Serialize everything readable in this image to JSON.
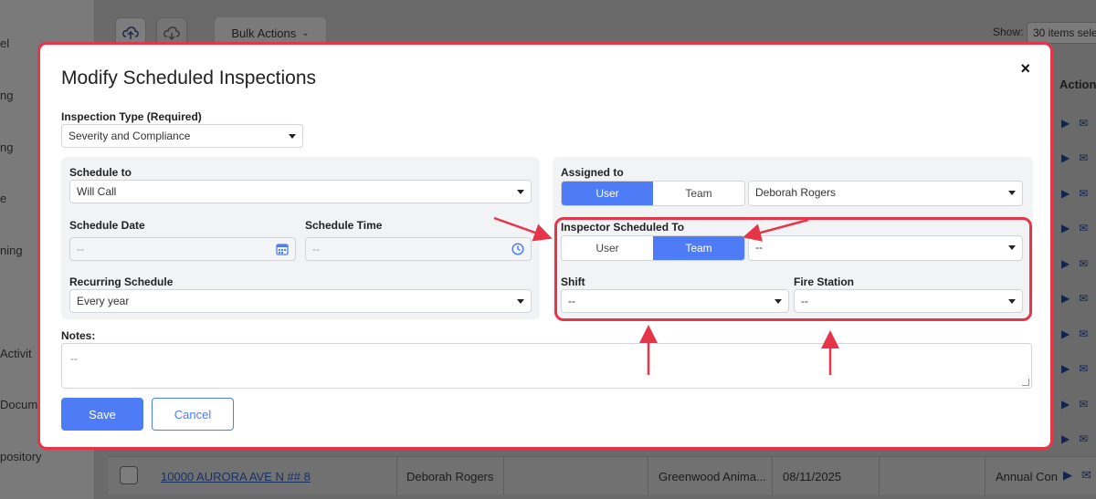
{
  "background": {
    "sidebar_items": [
      "el",
      "ng",
      "ng",
      "e",
      "ning",
      "Activit",
      "Docum",
      "pository"
    ],
    "bulk_actions_label": "Bulk Actions",
    "show_label": "Show:",
    "items_select_value": "30 items sele",
    "actions_header": "Action",
    "bottom_row": {
      "address": "10000 AURORA AVE N ## 8",
      "inspector": "Deborah Rogers",
      "facility": "Greenwood Anima...",
      "date": "08/11/2025",
      "type": "Annual Con"
    }
  },
  "modal": {
    "title": "Modify Scheduled Inspections",
    "close_label": "×",
    "inspection_type": {
      "label": "Inspection Type (Required)",
      "value": "Severity and Compliance"
    },
    "schedule_to": {
      "label": "Schedule to",
      "value": "Will Call"
    },
    "schedule_date": {
      "label": "Schedule Date",
      "placeholder": "--"
    },
    "schedule_time": {
      "label": "Schedule Time",
      "placeholder": "--"
    },
    "recurring": {
      "label": "Recurring Schedule",
      "value": "Every year"
    },
    "assigned_to": {
      "label": "Assigned to",
      "options": [
        "User",
        "Team"
      ],
      "selected": "User",
      "value": "Deborah Rogers"
    },
    "inspector_scheduled_to": {
      "label": "Inspector Scheduled To",
      "options": [
        "User",
        "Team"
      ],
      "selected": "Team",
      "value": "--"
    },
    "shift": {
      "label": "Shift",
      "value": "--"
    },
    "fire_station": {
      "label": "Fire Station",
      "value": "--"
    },
    "notes": {
      "label": "Notes:",
      "placeholder": "--"
    },
    "save_label": "Save",
    "cancel_label": "Cancel"
  },
  "colors": {
    "accent": "#4d7cf6",
    "annotation_red": "#e63449"
  }
}
